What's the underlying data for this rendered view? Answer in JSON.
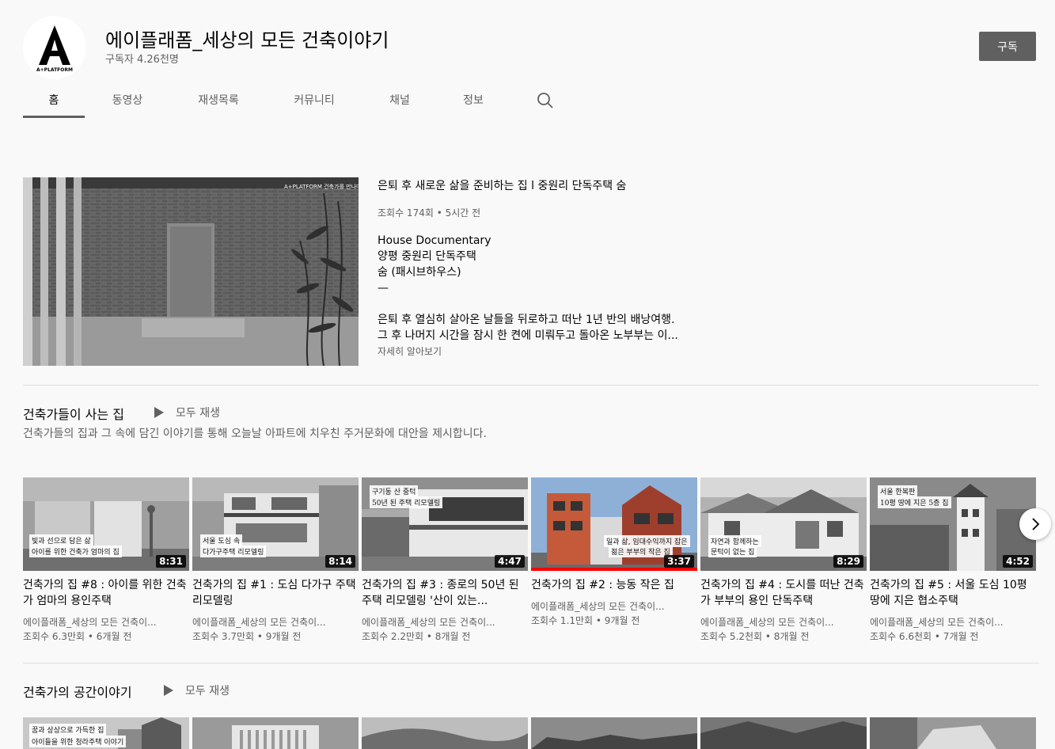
{
  "channel": {
    "name": "에이플래폼_세상의 모든 건축이야기",
    "subscribers": "구독자 4.26천명",
    "logo_text": "A+PLATFORM",
    "subscribe_label": "구독"
  },
  "tabs": [
    {
      "label": "홈",
      "active": true
    },
    {
      "label": "동영상"
    },
    {
      "label": "재생목록"
    },
    {
      "label": "커뮤니티"
    },
    {
      "label": "채널"
    },
    {
      "label": "정보"
    }
  ],
  "search_icon": "search-icon",
  "featured": {
    "title": "은퇴 후 새로운 삶을 준비하는 집 l 중원리 단독주택 숨",
    "meta": "조회수 174회 • 5시간 전",
    "desc_lines": [
      "House Documentary",
      "양평 중원리 단독주택",
      "숨 (패시브하우스)",
      "—",
      "",
      "은퇴 후 열심히 살아온 날들을 뒤로하고 떠난 1년 반의 배낭여행.",
      "그 후 나머지 시간을 잠시 한 켠에 미뤄두고 돌아온 노부부는 이..."
    ],
    "more_label": "자세히 알아보기",
    "thumb_label": "A+PLATFORM 건축가를 만나다"
  },
  "shelf1": {
    "title": "건축가들이 사는 집",
    "play_all": "모두 재생",
    "description": "건축가들의 집과 그 속에 담긴 이야기를 통해 오늘날 아파트에 치우친 주거문화에 대안을 제시합니다.",
    "videos": [
      {
        "title": "건축가의 집 #8 : 아이를 위한 건축가 엄마의 용인주택",
        "channel": "에이플래폼_세상의 모든 건축이...",
        "views": "조회수 6.3만회 • 6개월 전",
        "duration": "8:31",
        "overlay": [
          "빛과 선으로 담은 삶",
          "아이를 위한 건축가 엄마의 집"
        ]
      },
      {
        "title": "건축가의 집 #1 : 도심 다가구 주택 리모델링",
        "channel": "에이플래폼_세상의 모든 건축이...",
        "views": "조회수 3.7만회 • 9개월 전",
        "duration": "8:14",
        "overlay": [
          "서울 도심 속",
          "다가구주택 리모델링"
        ]
      },
      {
        "title": "건축가의 집 #3 : 종로의 50년 된 주택 리모델링 '산이 있는...",
        "channel": "에이플래폼_세상의 모든 건축이...",
        "views": "조회수 2.2만회 • 8개월 전",
        "duration": "4:47",
        "overlay": [
          "구기동 산 중턱",
          "50년 된 주택 리모델링"
        ]
      },
      {
        "title": "건축가의 집 #2 : 능동 작은 집",
        "channel": "에이플래폼_세상의 모든 건축이...",
        "views": "조회수 1.1만회 • 9개월 전",
        "duration": "3:37",
        "overlay": [
          "일과 삶, 임대수익까지 잡은",
          "젊은 부부의 작은 집"
        ],
        "progress": 1.0
      },
      {
        "title": "건축가의 집 #4 : 도시를 떠난 건축가 부부의 용인 단독주택",
        "channel": "에이플래폼_세상의 모든 건축이...",
        "views": "조회수 5.2천회 • 8개월 전",
        "duration": "8:29",
        "overlay": [
          "자연과 함께하는",
          "문턱이 없는 집"
        ]
      },
      {
        "title": "건축가의 집 #5 : 서울 도심 10평 땅에 지은 협소주택",
        "channel": "에이플래폼_세상의 모든 건축이...",
        "views": "조회수 6.6천회 • 7개월 전",
        "duration": "4:52",
        "overlay": [
          "서울 한복판",
          "10평 땅에 지은 5층 집"
        ]
      }
    ]
  },
  "shelf2": {
    "title": "건축가의 공간이야기",
    "play_all": "모두 재생",
    "overlay": [
      "꿈과 상상으로 가득한 집",
      "아이들을 위한 청라주택 이야기"
    ]
  },
  "next_icon": "chevron-right-icon"
}
